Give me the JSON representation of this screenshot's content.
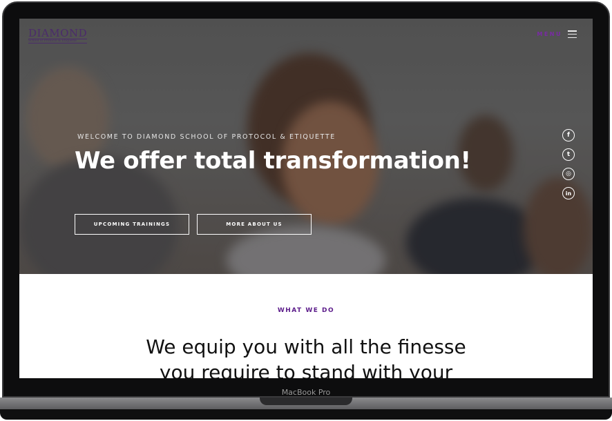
{
  "logo": {
    "name": "DIAMOND",
    "tagline": "School of Protocol & Etiquette"
  },
  "nav": {
    "menu_label": "MENU",
    "menu_icon": "hamburger-icon"
  },
  "hero": {
    "welcome": "WELCOME TO DIAMOND SCHOOL OF PROTOCOL & ETIQUETTE",
    "title": "We offer total transformation!",
    "buttons": [
      "UPCOMING TRAININGS",
      "MORE ABOUT US"
    ]
  },
  "social": [
    {
      "icon": "facebook-icon",
      "glyph": "f"
    },
    {
      "icon": "twitter-icon",
      "glyph": "t"
    },
    {
      "icon": "instagram-icon",
      "glyph": "◎"
    },
    {
      "icon": "linkedin-icon",
      "glyph": "in"
    }
  ],
  "section": {
    "eyebrow": "WHAT WE DO",
    "heading": "We equip you with all the finesse you require to stand with your"
  },
  "device": {
    "label": "MacBook Pro"
  },
  "colors": {
    "accent": "#5b1b8a",
    "logo": "#4b2b6b"
  }
}
